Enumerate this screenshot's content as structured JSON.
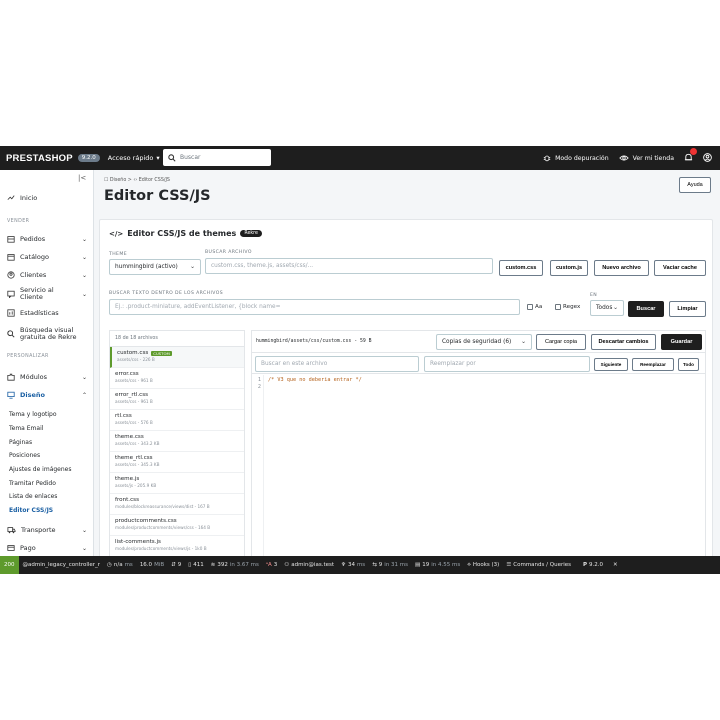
{
  "topbar": {
    "logo": "PRESTASHOP",
    "version": "9.2.0",
    "quick_access": "Acceso rápido",
    "search_placeholder": "Buscar",
    "debug_mode": "Modo depuración",
    "view_store": "Ver mi tienda"
  },
  "sidebar": {
    "inicio": "Inicio",
    "section_vender": "VENDER",
    "pedidos": "Pedidos",
    "catalogo": "Catálogo",
    "clientes": "Clientes",
    "servicio": "Servicio al Cliente",
    "estadisticas": "Estadísticas",
    "busqueda": "Búsqueda visual gratuita de Rekre",
    "section_personalizar": "PERSONALIZAR",
    "modulos": "Módulos",
    "diseno": "Diseño",
    "submenu": [
      "Tema y logotipo",
      "Tema Email",
      "Páginas",
      "Posiciones",
      "Ajustes de imágenes",
      "Tramitar Pedido",
      "Lista de enlaces",
      "Editor CSS/JS"
    ],
    "transporte": "Transporte",
    "pago": "Pago"
  },
  "header": {
    "breadcrumb": "☐ Diseño  >  ‹› Editor CSS/JS",
    "title": "Editor CSS/JS",
    "help": "Ayuda"
  },
  "card": {
    "title": "Editor CSS/JS de themes",
    "badge": "Rekre",
    "theme_label": "THEME",
    "theme_value": "hummingbird (activo)",
    "search_file_label": "BUSCAR ARCHIVO",
    "search_file_placeholder": "custom.css, theme.js, assets/css/...",
    "quick_buttons": [
      "custom.css",
      "custom.js"
    ],
    "new_file": "Nuevo archivo",
    "clear_cache": "Vaciar cache",
    "search_text_label": "BUSCAR TEXTO DENTRO DE LOS ARCHIVOS",
    "search_text_placeholder": "Ej.: .product-miniature, addEventListener, {block name=",
    "opt_case": "Aa",
    "opt_regex": "Regex",
    "in_label": "EN",
    "in_value": "Todos",
    "search_btn": "Buscar",
    "clear_btn": "Limpiar"
  },
  "files": {
    "count": "18 de 18 archivos",
    "custom_tag": "CUSTOM",
    "items": [
      {
        "name": "custom.css",
        "path": "assets/css - 226 B"
      },
      {
        "name": "error.css",
        "path": "assets/css - 961 B"
      },
      {
        "name": "error_rtl.css",
        "path": "assets/css - 961 B"
      },
      {
        "name": "rtl.css",
        "path": "assets/css - 576 B"
      },
      {
        "name": "theme.css",
        "path": "assets/css - 343.2 KB"
      },
      {
        "name": "theme_rtl.css",
        "path": "assets/css - 345.3 KB"
      },
      {
        "name": "theme.js",
        "path": "assets/js - 205.9 KB"
      },
      {
        "name": "front.css",
        "path": "modules/blockreassurance/views/dist - 167 B"
      },
      {
        "name": "productcomments.css",
        "path": "modules/productcomments/views/css - 164 B"
      },
      {
        "name": "list-comments.js",
        "path": "modules/productcomments/views/js - 1k0 B"
      }
    ]
  },
  "editor": {
    "path": "hummingbird/assets/css/custom.css - 59 B",
    "backups": "Copias de seguridad (6)",
    "load_copy": "Cargar copia",
    "discard": "Descartar cambios",
    "save": "Guardar",
    "find_placeholder": "Buscar en este archivo",
    "replace_placeholder": "Reemplazar por",
    "next": "Siguiente",
    "replace": "Reemplazar",
    "replace_all": "Todo",
    "line_numbers": [
      "1",
      "2"
    ],
    "code_line_1": "/* V3 que no deberia entrar */"
  },
  "debugbar": {
    "status": "200",
    "route": "@admin_legacy_controller_r",
    "time": "n/a",
    "time_unit": "ms",
    "memory": "16.0",
    "memory_unit": "MiB",
    "forms": "9",
    "files": "411",
    "cache": "392",
    "cache_time": "in 3.67 ms",
    "translations": "3",
    "user": "admin@ias.test",
    "twig": "34",
    "twig_unit": "ms",
    "http": "9",
    "http_time": "in 31 ms",
    "db": "19",
    "db_time": "in 4.55 ms",
    "hooks": "Hooks (3)",
    "commands": "Commands / Queries",
    "ps_version": "9.2.0",
    "ps_prefix": "P",
    "close": "✕"
  }
}
